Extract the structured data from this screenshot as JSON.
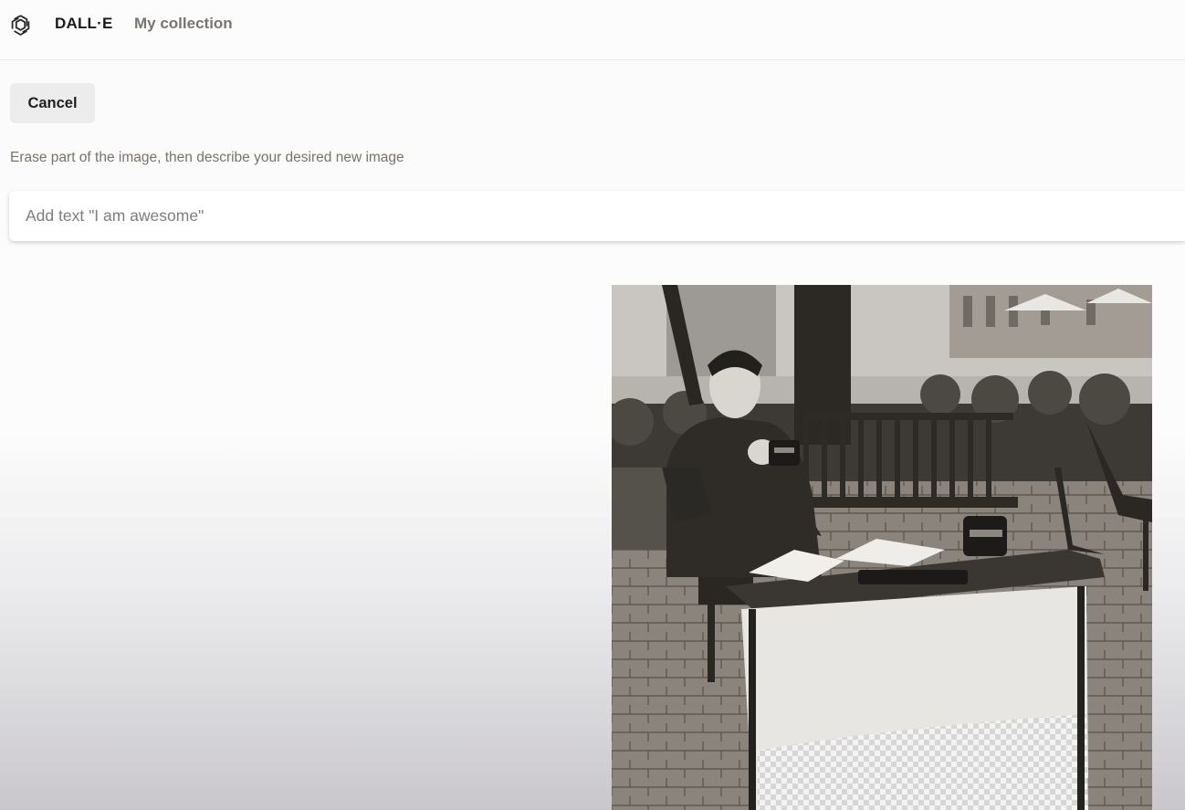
{
  "header": {
    "brand": "DALL·E",
    "nav_collection": "My collection",
    "logo_icon": "openai-logo-icon"
  },
  "editor": {
    "cancel_label": "Cancel",
    "instruction": "Erase part of the image, then describe your desired new image",
    "prompt_value": "Add text \"I am awesome\""
  },
  "image": {
    "description_icon": "photo-man-at-table-with-erased-sign",
    "erased_region_icon": "transparency-checkerboard"
  },
  "colors": {
    "brand_text": "#1a1a1a",
    "nav_text": "#7a7470",
    "cancel_bg": "#ececec",
    "instruction_text": "#7a716b"
  }
}
